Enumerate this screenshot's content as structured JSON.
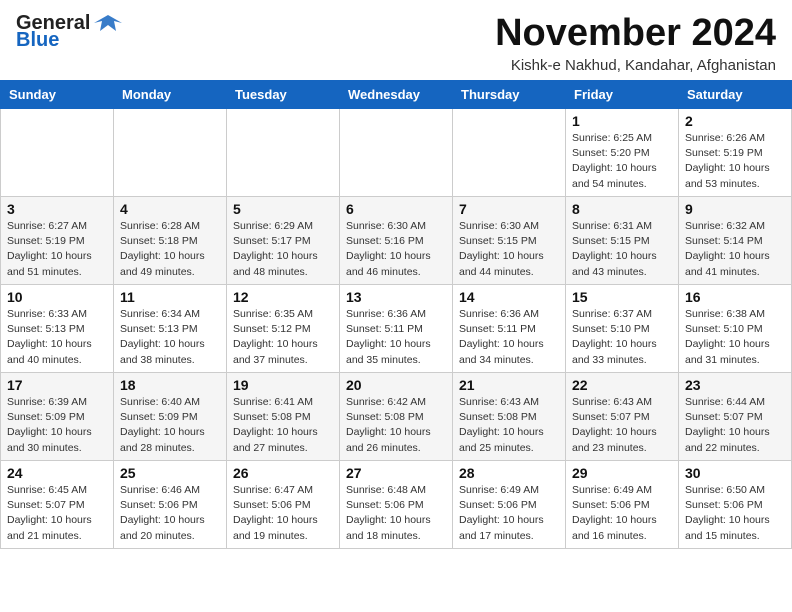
{
  "header": {
    "logo_general": "General",
    "logo_blue": "Blue",
    "month_title": "November 2024",
    "location": "Kishk-e Nakhud, Kandahar, Afghanistan"
  },
  "weekdays": [
    "Sunday",
    "Monday",
    "Tuesday",
    "Wednesday",
    "Thursday",
    "Friday",
    "Saturday"
  ],
  "weeks": [
    [
      {
        "day": "",
        "info": ""
      },
      {
        "day": "",
        "info": ""
      },
      {
        "day": "",
        "info": ""
      },
      {
        "day": "",
        "info": ""
      },
      {
        "day": "",
        "info": ""
      },
      {
        "day": "1",
        "info": "Sunrise: 6:25 AM\nSunset: 5:20 PM\nDaylight: 10 hours\nand 54 minutes."
      },
      {
        "day": "2",
        "info": "Sunrise: 6:26 AM\nSunset: 5:19 PM\nDaylight: 10 hours\nand 53 minutes."
      }
    ],
    [
      {
        "day": "3",
        "info": "Sunrise: 6:27 AM\nSunset: 5:19 PM\nDaylight: 10 hours\nand 51 minutes."
      },
      {
        "day": "4",
        "info": "Sunrise: 6:28 AM\nSunset: 5:18 PM\nDaylight: 10 hours\nand 49 minutes."
      },
      {
        "day": "5",
        "info": "Sunrise: 6:29 AM\nSunset: 5:17 PM\nDaylight: 10 hours\nand 48 minutes."
      },
      {
        "day": "6",
        "info": "Sunrise: 6:30 AM\nSunset: 5:16 PM\nDaylight: 10 hours\nand 46 minutes."
      },
      {
        "day": "7",
        "info": "Sunrise: 6:30 AM\nSunset: 5:15 PM\nDaylight: 10 hours\nand 44 minutes."
      },
      {
        "day": "8",
        "info": "Sunrise: 6:31 AM\nSunset: 5:15 PM\nDaylight: 10 hours\nand 43 minutes."
      },
      {
        "day": "9",
        "info": "Sunrise: 6:32 AM\nSunset: 5:14 PM\nDaylight: 10 hours\nand 41 minutes."
      }
    ],
    [
      {
        "day": "10",
        "info": "Sunrise: 6:33 AM\nSunset: 5:13 PM\nDaylight: 10 hours\nand 40 minutes."
      },
      {
        "day": "11",
        "info": "Sunrise: 6:34 AM\nSunset: 5:13 PM\nDaylight: 10 hours\nand 38 minutes."
      },
      {
        "day": "12",
        "info": "Sunrise: 6:35 AM\nSunset: 5:12 PM\nDaylight: 10 hours\nand 37 minutes."
      },
      {
        "day": "13",
        "info": "Sunrise: 6:36 AM\nSunset: 5:11 PM\nDaylight: 10 hours\nand 35 minutes."
      },
      {
        "day": "14",
        "info": "Sunrise: 6:36 AM\nSunset: 5:11 PM\nDaylight: 10 hours\nand 34 minutes."
      },
      {
        "day": "15",
        "info": "Sunrise: 6:37 AM\nSunset: 5:10 PM\nDaylight: 10 hours\nand 33 minutes."
      },
      {
        "day": "16",
        "info": "Sunrise: 6:38 AM\nSunset: 5:10 PM\nDaylight: 10 hours\nand 31 minutes."
      }
    ],
    [
      {
        "day": "17",
        "info": "Sunrise: 6:39 AM\nSunset: 5:09 PM\nDaylight: 10 hours\nand 30 minutes."
      },
      {
        "day": "18",
        "info": "Sunrise: 6:40 AM\nSunset: 5:09 PM\nDaylight: 10 hours\nand 28 minutes."
      },
      {
        "day": "19",
        "info": "Sunrise: 6:41 AM\nSunset: 5:08 PM\nDaylight: 10 hours\nand 27 minutes."
      },
      {
        "day": "20",
        "info": "Sunrise: 6:42 AM\nSunset: 5:08 PM\nDaylight: 10 hours\nand 26 minutes."
      },
      {
        "day": "21",
        "info": "Sunrise: 6:43 AM\nSunset: 5:08 PM\nDaylight: 10 hours\nand 25 minutes."
      },
      {
        "day": "22",
        "info": "Sunrise: 6:43 AM\nSunset: 5:07 PM\nDaylight: 10 hours\nand 23 minutes."
      },
      {
        "day": "23",
        "info": "Sunrise: 6:44 AM\nSunset: 5:07 PM\nDaylight: 10 hours\nand 22 minutes."
      }
    ],
    [
      {
        "day": "24",
        "info": "Sunrise: 6:45 AM\nSunset: 5:07 PM\nDaylight: 10 hours\nand 21 minutes."
      },
      {
        "day": "25",
        "info": "Sunrise: 6:46 AM\nSunset: 5:06 PM\nDaylight: 10 hours\nand 20 minutes."
      },
      {
        "day": "26",
        "info": "Sunrise: 6:47 AM\nSunset: 5:06 PM\nDaylight: 10 hours\nand 19 minutes."
      },
      {
        "day": "27",
        "info": "Sunrise: 6:48 AM\nSunset: 5:06 PM\nDaylight: 10 hours\nand 18 minutes."
      },
      {
        "day": "28",
        "info": "Sunrise: 6:49 AM\nSunset: 5:06 PM\nDaylight: 10 hours\nand 17 minutes."
      },
      {
        "day": "29",
        "info": "Sunrise: 6:49 AM\nSunset: 5:06 PM\nDaylight: 10 hours\nand 16 minutes."
      },
      {
        "day": "30",
        "info": "Sunrise: 6:50 AM\nSunset: 5:06 PM\nDaylight: 10 hours\nand 15 minutes."
      }
    ]
  ]
}
